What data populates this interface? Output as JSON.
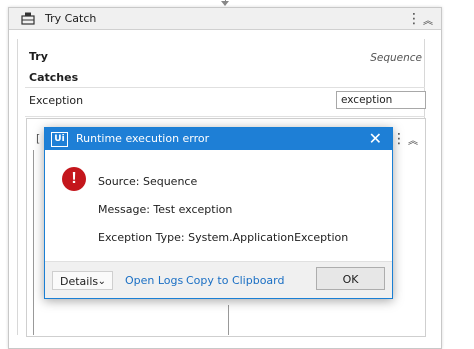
{
  "activity": {
    "title": "Try Catch",
    "try_label": "Try",
    "try_value": "Sequence",
    "catches_label": "Catches",
    "exception_type": "Exception",
    "exception_variable": "exception",
    "inner_bracket": "["
  },
  "dialog": {
    "logo_text": "Ui",
    "title": "Runtime execution error",
    "close_glyph": "✕",
    "error_glyph": "!",
    "source": "Source: Sequence",
    "message": "Message: Test exception",
    "exception_type": "Exception Type: System.ApplicationException",
    "details_label": "Details",
    "details_chevron": "⌄",
    "open_logs": "Open Logs",
    "copy_clipboard": "Copy to Clipboard",
    "ok_label": "OK"
  },
  "icons": {
    "kebab": "⋮",
    "collapse": "︽"
  },
  "colors": {
    "dialog_title_bg": "#1e7fd6",
    "error_red": "#c4161c",
    "link_blue": "#1a6fc4"
  }
}
